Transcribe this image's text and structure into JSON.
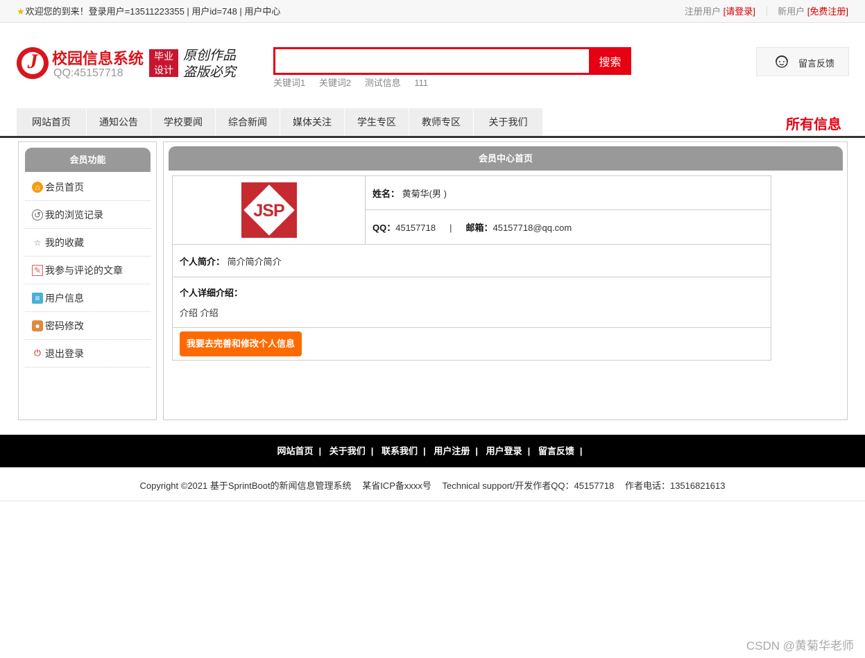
{
  "topbar": {
    "welcome": "欢迎您的到来！登录用户=13511223355 | 用户id=748 | 用户中心",
    "register_label": "注册用户",
    "login_link": "[请登录]",
    "newuser_label": "新用户",
    "free_register_link": "[免费注册]"
  },
  "header": {
    "logo_letter": "J",
    "site_title": "校园信息系统",
    "site_qq": "QQ:45157718",
    "badge_line1": "毕业",
    "badge_line2": "设计",
    "slogan_line1": "原创作品",
    "slogan_line2": "盗版必究"
  },
  "search": {
    "placeholder": "",
    "button_label": "搜索",
    "keywords": [
      "关键词1",
      "关键词2",
      "测试信息",
      "111"
    ]
  },
  "feedback": {
    "label": "留言反馈"
  },
  "nav": {
    "items": [
      "网站首页",
      "通知公告",
      "学校要闻",
      "综合新闻",
      "媒体关注",
      "学生专区",
      "教师专区",
      "关于我们"
    ],
    "all_info": "所有信息"
  },
  "sidebar": {
    "title": "会员功能",
    "items": [
      {
        "label": "会员首页",
        "icon": "home-icon"
      },
      {
        "label": "我的浏览记录",
        "icon": "history-icon"
      },
      {
        "label": "我的收藏",
        "icon": "star-icon"
      },
      {
        "label": "我参与评论的文章",
        "icon": "edit-icon"
      },
      {
        "label": "用户信息",
        "icon": "user-info-icon"
      },
      {
        "label": "密码修改",
        "icon": "lock-icon"
      },
      {
        "label": "退出登录",
        "icon": "power-icon"
      }
    ]
  },
  "main": {
    "title": "会员中心首页",
    "avatar_text": "JSP",
    "name_label": "姓名：",
    "name_value": "黄菊华(男 )",
    "qq_label": "QQ：",
    "qq_value": "45157718",
    "pipe": "|",
    "email_label": "邮箱：",
    "email_value": "45157718@qq.com",
    "intro_label": "个人简介：",
    "intro_value": "简介简介简介",
    "detail_label": "个人详细介绍：",
    "detail_value": "介绍  介绍",
    "edit_button": "我要去完善和修改个人信息"
  },
  "footer": {
    "links": [
      "网站首页",
      "关于我们",
      "联系我们",
      "用户注册",
      "用户登录",
      "留言反馈"
    ],
    "separator": "|",
    "copyright": "Copyright ©2021 基于SprintBoot的新闻信息管理系统",
    "icp": "某省ICP备xxxx号",
    "support": "Technical support/开发作者QQ：45157718",
    "phone": "作者电话：13516821613"
  },
  "watermark": "CSDN @黄菊华老师",
  "colors": {
    "accent_red": "#e60012",
    "button_orange": "#ff6a00",
    "header_gray": "#999999"
  }
}
